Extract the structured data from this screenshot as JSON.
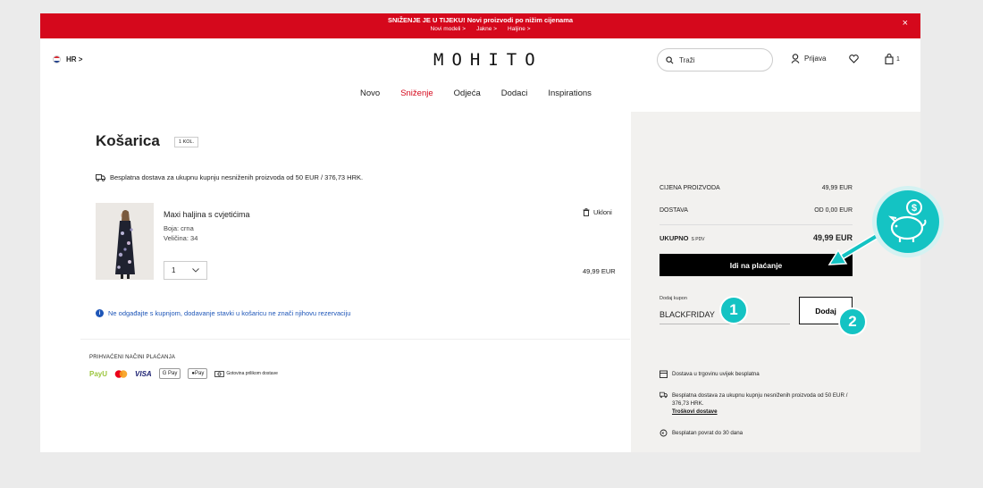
{
  "promo": {
    "title": "SNIŽENJE JE U TIJEKU! Novi proizvodi po nižim cijenama",
    "links": [
      "Novi modeli >",
      "Jakne >",
      "Haljine >"
    ],
    "close": "×"
  },
  "header": {
    "lang": "HR >",
    "logo": "MOHITO",
    "search_placeholder": "Traži",
    "login": "Prijava",
    "cart_count": "1",
    "icons": [
      "croatia-flag-icon",
      "search-icon",
      "user-icon",
      "heart-icon",
      "bag-icon"
    ]
  },
  "nav": [
    "Novo",
    "Sniženje",
    "Odjeća",
    "Dodaci",
    "Inspirations"
  ],
  "cart": {
    "title": "Košarica",
    "count_badge": "1 KOL.",
    "free_shipping": "Besplatna dostava za ukupnu kupnju nesniženih proizvoda od 50 EUR / 376,73 HRK.",
    "item": {
      "name": "Maxi haljina s cvjetićima",
      "color": "Boja: crna",
      "size": "Veličina: 34",
      "remove": "Ukloni",
      "quantity": "1",
      "price": "49,99 EUR"
    },
    "note": "Ne odgađajte s kupnjom, dodavanje stavki u košaricu ne znači njihovu rezervaciju"
  },
  "payment": {
    "title": "PRIHVAĆENI NAČINI PLAĆANJA",
    "methods": [
      "PayU",
      "VISA",
      "G Pay",
      "Pay"
    ],
    "cod": "Gotovina prilikom dostave"
  },
  "summary": {
    "product_price_label": "CIJENA PROIZVODA",
    "product_price": "49,99 EUR",
    "delivery_label": "DOSTAVA",
    "delivery_price": "OD 0,00 EUR",
    "total_label": "UKUPNO",
    "total_vat": "S PDV",
    "total": "49,99 EUR",
    "checkout": "Idi na plaćanje",
    "coupon_label": "Dodaj kupon",
    "coupon_value": "BLACKFRIDAY",
    "add_button": "Dodaj",
    "benefits": [
      {
        "text": "Dostava u trgovinu uvijek besplatna"
      },
      {
        "text": "Besplatna dostava za ukupnu kupnju nesniženih proizvoda od 50 EUR / 376,73 HRK.",
        "link": "Troškovi dostave"
      },
      {
        "text": "Besplatan povrat do 30 dana"
      }
    ]
  },
  "overlay": {
    "step1": "1",
    "step2": "2",
    "colors": {
      "accent": "#14c3c3",
      "sale": "#d5081c",
      "info": "#1e56b8"
    }
  }
}
